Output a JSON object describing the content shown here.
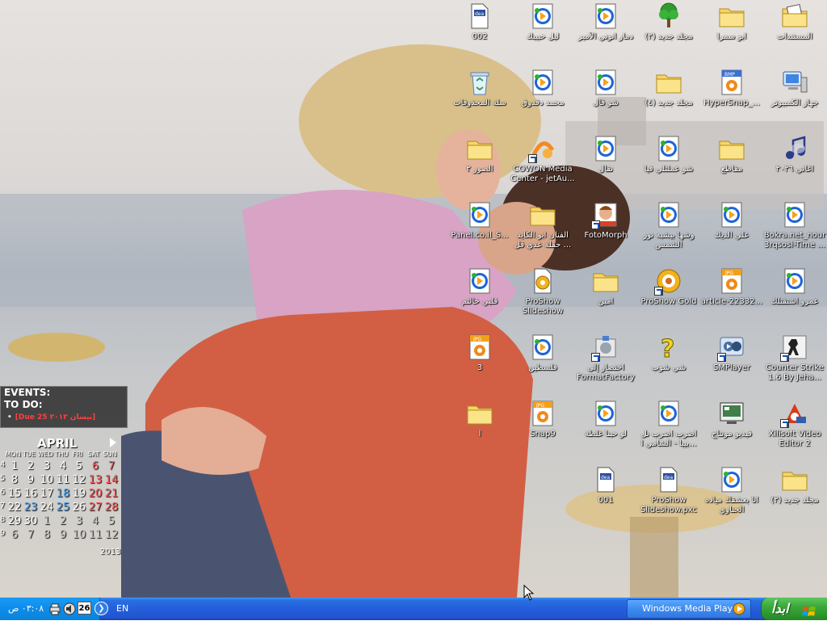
{
  "desktop": {
    "icons": [
      {
        "label": "المستندات",
        "type": "folder-docs"
      },
      {
        "label": "ابو سمرا",
        "type": "folder"
      },
      {
        "label": "(مجلد جديد (٢",
        "type": "tree"
      },
      {
        "label": "دمار انوني الأمير",
        "type": "media"
      },
      {
        "label": "ليل حبيبك",
        "type": "media"
      },
      {
        "label": "002",
        "type": "doc"
      },
      {
        "label": "جهاز الكمبيوتر",
        "type": "computer"
      },
      {
        "label": "HyperSnap_...",
        "type": "bmp"
      },
      {
        "label": "(مجلد جديد (٤",
        "type": "folder"
      },
      {
        "label": "شو قال",
        "type": "media"
      },
      {
        "label": "محمد دقدوق",
        "type": "media"
      },
      {
        "label": "سلة المحذوفات",
        "type": "recycle"
      },
      {
        "label": "اغاني ٢٠٢٦",
        "type": "music"
      },
      {
        "label": "مقاطع",
        "type": "folder"
      },
      {
        "label": "شو عملتلي فيا",
        "type": "media"
      },
      {
        "label": "نقال",
        "type": "media"
      },
      {
        "label": "COWON Media Center - jetAu...",
        "type": "cowon"
      },
      {
        "label": "الصور ٢",
        "type": "folder"
      },
      {
        "label": "Bokra.net_nour 3rqsosi-Time ...",
        "type": "media"
      },
      {
        "label": "علي الديك",
        "type": "media"
      },
      {
        "label": "وشها بيشبه نور الشمس",
        "type": "media"
      },
      {
        "label": "FotoMorph",
        "type": "fotomorph"
      },
      {
        "label": "الفنان ابو الكايد حفلة عدي قل ...",
        "type": "folder"
      },
      {
        "label": "Panel.co.il_S...",
        "type": "media"
      },
      {
        "label": "عمرو اشتقتلك",
        "type": "media"
      },
      {
        "label": "article-22332...",
        "type": "jpg"
      },
      {
        "label": "ProShow Gold",
        "type": "proshow"
      },
      {
        "label": "امين",
        "type": "folder"
      },
      {
        "label": "ProShow Slideshow",
        "type": "proshow-doc"
      },
      {
        "label": "قلبي خالتم",
        "type": "media"
      },
      {
        "label": "Counter Strike 1.6 By Jeha...",
        "type": "cs"
      },
      {
        "label": "SMPlayer",
        "type": "smplayer"
      },
      {
        "label": "شي شوب",
        "type": "help"
      },
      {
        "label": "اختصار إلى FormatFactory",
        "type": "formatfactory"
      },
      {
        "label": "فلسطين",
        "type": "media"
      },
      {
        "label": "3",
        "type": "jpg"
      },
      {
        "label": "Xilisoft Video Editor 2",
        "type": "xilisoft"
      },
      {
        "label": "فيديو مونتاج",
        "type": "screen"
      },
      {
        "label": "اضرب اضرب نل بيبا - الشامي ا...",
        "type": "media"
      },
      {
        "label": "لو حبنا غلطة",
        "type": "media"
      },
      {
        "label": "Snap9",
        "type": "jpg"
      },
      {
        "label": "ا",
        "type": "folder"
      },
      {
        "label": "(مجلد جديد (٢",
        "type": "folder"
      },
      {
        "label": "انا بعشقك مياده الحناوي",
        "type": "media"
      },
      {
        "label": "ProShow Slideshow.pxc",
        "type": "doc"
      },
      {
        "label": "001",
        "type": "doc"
      }
    ]
  },
  "widgets": {
    "events": {
      "events_label": "EVENTS:",
      "todo_label": "TO DO:",
      "todo_item": "[Due 25 نيسان ٢٠١٣]"
    },
    "calendar": {
      "month": "APRIL",
      "year": "2013",
      "dow": [
        "MON",
        "TUE",
        "WED",
        "THU",
        "FRI",
        "SAT",
        "SUN"
      ],
      "weeks": [
        {
          "wk": "4",
          "days": [
            "1",
            "2",
            "3",
            "4",
            "5",
            "6",
            "7"
          ]
        },
        {
          "wk": "5",
          "days": [
            "8",
            "9",
            "10",
            "11",
            "12",
            "13",
            "14"
          ]
        },
        {
          "wk": "6",
          "days": [
            "15",
            "16",
            "17",
            "18",
            "19",
            "20",
            "21"
          ]
        },
        {
          "wk": "7",
          "days": [
            "22",
            "23",
            "24",
            "25",
            "26",
            "27",
            "28"
          ]
        },
        {
          "wk": "8",
          "days": [
            "29",
            "30",
            "1",
            "2",
            "3",
            "4",
            "5"
          ]
        },
        {
          "wk": "9",
          "days": [
            "6",
            "7",
            "8",
            "9",
            "10",
            "11",
            "12"
          ]
        }
      ],
      "today": "26"
    }
  },
  "taskbar": {
    "clock": "٠٣:٠٨ ص",
    "date_badge": "26",
    "language": "EN",
    "task_label": "Windows Media Player",
    "start_label": "ابدأ"
  },
  "colors": {
    "taskbar_blue": "#245edb",
    "start_green": "#3aa83a",
    "calendar_red": "#ff5b5b",
    "calendar_blue": "#46a6ff",
    "today_ring": "#d8181a"
  }
}
